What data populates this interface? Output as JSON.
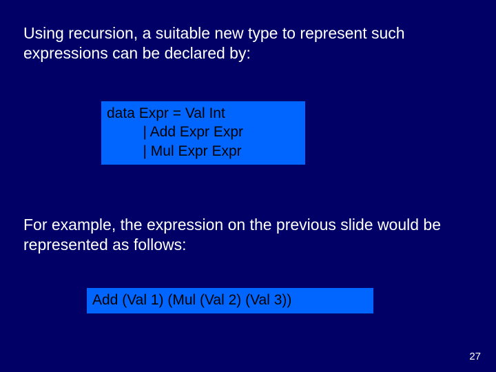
{
  "para1": "Using recursion, a suitable new type to represent such expressions can be declared by:",
  "code1_line1": "data Expr = Val Int",
  "code1_line2": "         | Add Expr Expr",
  "code1_line3": "         | Mul Expr Expr",
  "para2": "For example, the expression on the previous slide would be represented as follows:",
  "code2_line1": "Add (Val 1) (Mul (Val 2) (Val 3))",
  "page_number": "27"
}
